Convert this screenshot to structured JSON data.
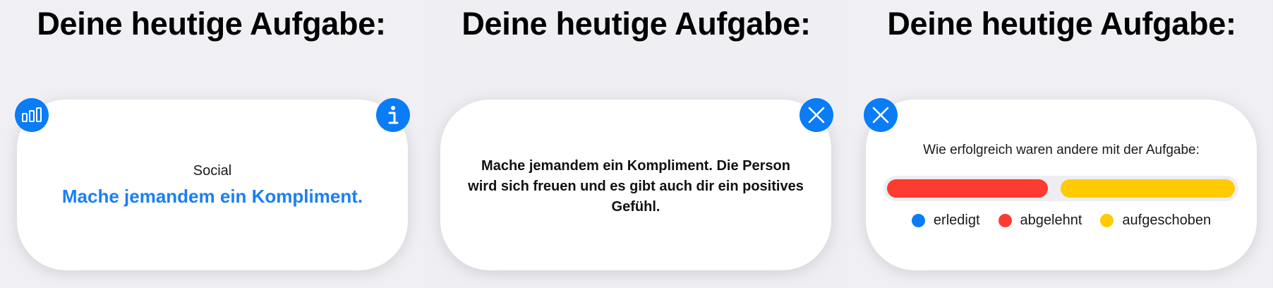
{
  "heading": "Deine heutige Aufgabe:",
  "panels": {
    "overview": {
      "category": "Social",
      "task": "Mache jemandem ein Kompliment."
    },
    "detail": {
      "text": "Mache jemandem ein Kompliment. Die Person wird sich freuen und es gibt auch dir ein positives Gefühl."
    },
    "stats": {
      "question": "Wie erfolgreich waren andere mit der Aufgabe:",
      "distribution": [
        {
          "key": "erledigt",
          "share": 0,
          "color": "#0a7cf6"
        },
        {
          "key": "abgelehnt",
          "share": 0.48,
          "color": "#fd3b30"
        },
        {
          "key": "aufgeschoben",
          "share": 0.52,
          "color": "#ffcb00"
        }
      ],
      "legend": {
        "done": "erledigt",
        "declined": "abgelehnt",
        "postponed": "aufgeschoben"
      }
    }
  },
  "colors": {
    "accent": "#0a7cf6",
    "task_text": "#1b7ff2",
    "declined": "#fd3b30",
    "postponed": "#ffcb00",
    "background": "#eeeef3",
    "card": "#ffffff"
  },
  "icons": {
    "stats_button": "bar-chart-icon",
    "info_button": "info-icon",
    "close_button": "close-icon"
  }
}
